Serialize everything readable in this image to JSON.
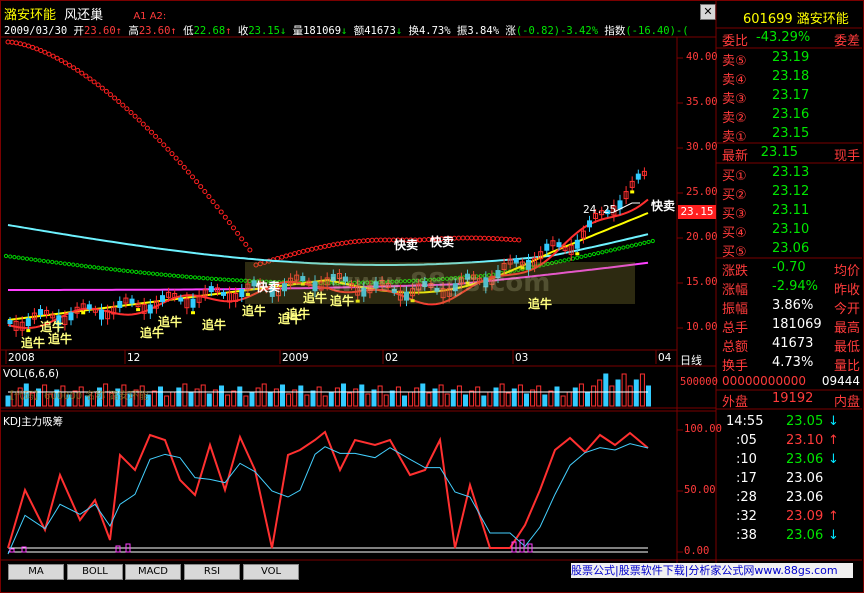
{
  "stock": {
    "name": "潞安环能",
    "tag": "风还巢",
    "code": "601699",
    "ind_tag": "A1 A2:"
  },
  "info_line": {
    "date": "2009/03/30",
    "open_label": "开",
    "open": "23.60",
    "high_label": "高",
    "high": "23.60",
    "low_label": "低",
    "low": "22.68",
    "close_label": "收",
    "close": "23.15",
    "vol_label": "量",
    "vol": "181069",
    "amt_label": "额",
    "amt": "41673",
    "turn_label": "换",
    "turn": "4.73%",
    "amp_label": "振",
    "amp": "3.84%",
    "chg_label": "涨",
    "chg": "(-0.82)-3.42%",
    "idx_label": "指数",
    "idx": "(-16.40)-("
  },
  "main_axis": [
    "40.00",
    "35.00",
    "30.00",
    "25.00",
    "20.00",
    "15.00",
    "10.00"
  ],
  "date_axis": [
    "2008",
    "12",
    "2009",
    "02",
    "03",
    "04"
  ],
  "period_label": "日线",
  "price_tag": "23.15",
  "peak_label": "24.25",
  "annotations": {
    "chase": "追牛",
    "sell": "快卖"
  },
  "vol_panel": {
    "title": "VOL(6,6,6)",
    "axis_top": "500000",
    "overlay": "【代码】600000  名称  潞安环能"
  },
  "kdj_panel": {
    "title": "KDJ主力吸筹",
    "axis": [
      "100.00",
      "50.00",
      "0.00"
    ]
  },
  "tabs": [
    "MA",
    "BOLL",
    "MACD",
    "RSI",
    "VOL"
  ],
  "footer_text": "股票公式|股票软件下载|分析家公式网www.88gs.com",
  "watermark": "www.88gs.com",
  "side": {
    "code": "601699",
    "name": "潞安环能",
    "weibi_label": "委比",
    "weibi": "-43.29%",
    "weicha_label": "委差",
    "sell": [
      {
        "label": "卖⑤",
        "price": "23.19"
      },
      {
        "label": "卖④",
        "price": "23.18"
      },
      {
        "label": "卖③",
        "price": "23.17"
      },
      {
        "label": "卖②",
        "price": "23.16"
      },
      {
        "label": "卖①",
        "price": "23.15"
      }
    ],
    "latest_label": "最新",
    "latest": "23.15",
    "hand_label": "现手",
    "buy": [
      {
        "label": "买①",
        "price": "23.13"
      },
      {
        "label": "买②",
        "price": "23.12"
      },
      {
        "label": "买③",
        "price": "23.11"
      },
      {
        "label": "买④",
        "price": "23.10"
      },
      {
        "label": "买⑤",
        "price": "23.06"
      }
    ],
    "stats": [
      {
        "label": "涨跌",
        "value": "-0.70",
        "suffix": "均价"
      },
      {
        "label": "涨幅",
        "value": "-2.94%",
        "suffix": "昨收"
      },
      {
        "label": "振幅",
        "value": "3.86%",
        "suffix": "今开"
      },
      {
        "label": "总手",
        "value": "181069",
        "suffix": "最高"
      },
      {
        "label": "总额",
        "value": "41673",
        "suffix": "最低"
      },
      {
        "label": "换手",
        "value": "4.73%",
        "suffix": "量比"
      }
    ],
    "long_num": "00000000000",
    "long_num2": "09444",
    "outer_label": "外盘",
    "outer": "19192",
    "inner_label": "内盘",
    "trades": [
      {
        "time": "14:55",
        "price": "23.05",
        "dir": "↓"
      },
      {
        "time": ":05",
        "price": "23.10",
        "dir": "↑"
      },
      {
        "time": ":10",
        "price": "23.06",
        "dir": "↓"
      },
      {
        "time": ":17",
        "price": "23.06",
        "dir": ""
      },
      {
        "time": ":28",
        "price": "23.06",
        "dir": ""
      },
      {
        "time": ":32",
        "price": "23.09",
        "dir": "↑"
      },
      {
        "time": ":38",
        "price": "23.06",
        "dir": "↓"
      }
    ]
  },
  "colors": {
    "up": "#ff3b3b",
    "down": "#00e5ff",
    "frame": "#7a0000",
    "ma_yellow": "#ffff00",
    "ma_cyan": "#6ef2ff",
    "ma_magenta": "#ff40ff"
  }
}
